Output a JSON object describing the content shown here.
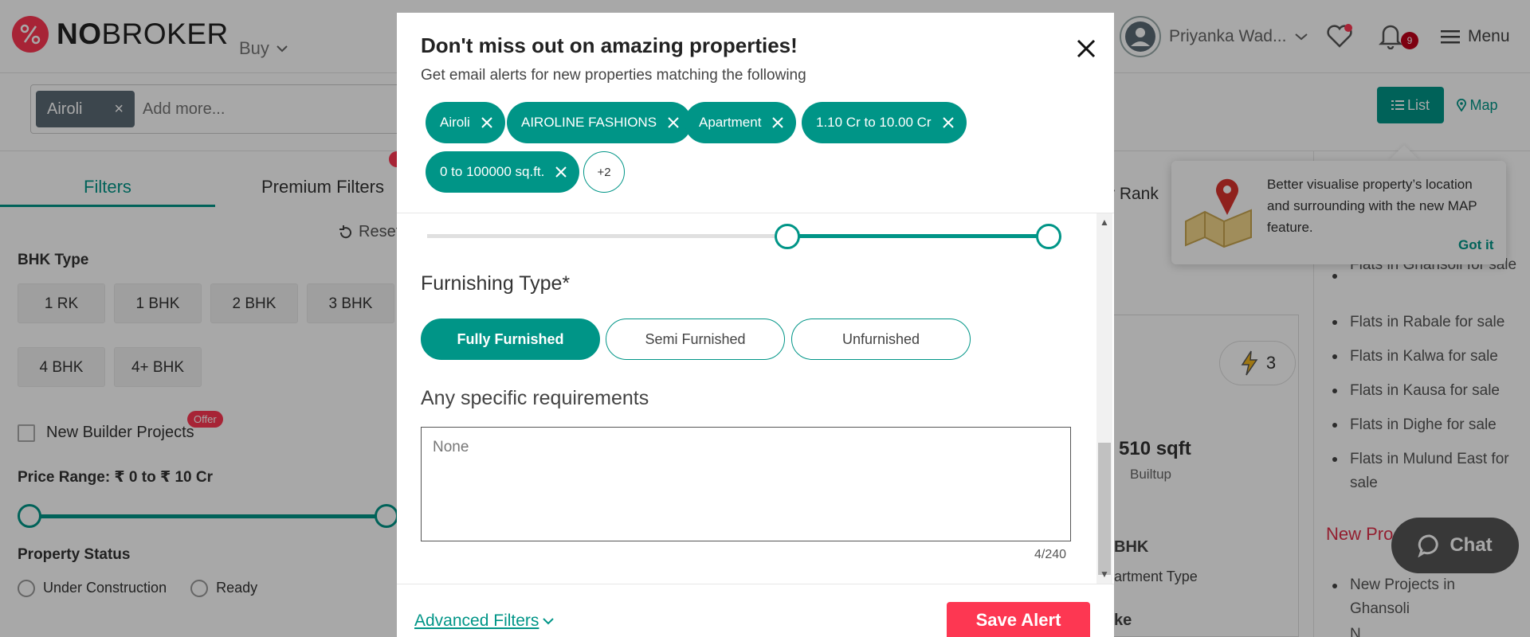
{
  "header": {
    "logo_no": "NO",
    "logo_broker": "BROKER",
    "buy_label": "Buy",
    "user_name": "Priyanka Wad...",
    "notification_count": "9",
    "menu_label": "Menu"
  },
  "search": {
    "location_chip": "Airoli",
    "chip_close": "×",
    "placeholder": "Add more...",
    "list_label": "List",
    "map_label": "Map"
  },
  "filters": {
    "tab_filters": "Filters",
    "tab_premium": "Premium Filters",
    "reset": "Reset",
    "bhk_label": "BHK Type",
    "bhk_options": [
      "1 RK",
      "1 BHK",
      "2 BHK",
      "3 BHK",
      "4 BHK",
      "4+ BHK"
    ],
    "new_builder": "New Builder Projects",
    "offer": "Offer",
    "price_range": "Price Range: ₹ 0 to ₹ 10 Cr",
    "property_status": "Property Status",
    "status_options": [
      "Under Construction",
      "Ready"
    ]
  },
  "listing": {
    "sort_fragment": "r Rank",
    "bolt_count": "3",
    "sqft": "510 sqft",
    "builtup": "Builtup",
    "row1": "BHK",
    "row1_sub": "artment Type",
    "row2": "ke"
  },
  "tooltip": {
    "text": "Better visualise property’s location and surrounding with the new MAP feature.",
    "got_it": "Got it"
  },
  "sidebar": {
    "links": [
      "Flats in Ghansoli for sale",
      "Flats in Rabale for sale",
      "Flats in Kalwa for sale",
      "Flats in Kausa for sale",
      "Flats in Dighe for sale",
      "Flats in Mulund East for sale"
    ],
    "new_projects": "New Pro",
    "project_links": [
      "New Projects in Ghansoli",
      "N"
    ]
  },
  "chat": {
    "label": "Chat"
  },
  "modal": {
    "title": "Don't miss out on amazing properties!",
    "subtitle": "Get email alerts for new properties matching the following",
    "chips": [
      "Airoli",
      "AIROLINE FASHIONS",
      "Apartment",
      "1.10 Cr to 10.00 Cr",
      "0 to 100000 sq.ft."
    ],
    "chip_more": "+2",
    "furnishing_label": "Furnishing Type*",
    "furnishing_options": [
      "Fully Furnished",
      "Semi Furnished",
      "Unfurnished"
    ],
    "furnishing_selected": "Fully Furnished",
    "requirements_label": "Any specific requirements",
    "requirements_value": "None",
    "char_count": "4/240",
    "advanced_filters": "Advanced Filters",
    "save_alert": "Save Alert"
  },
  "colors": {
    "brand_teal": "#009587",
    "brand_red": "#fd3752"
  }
}
